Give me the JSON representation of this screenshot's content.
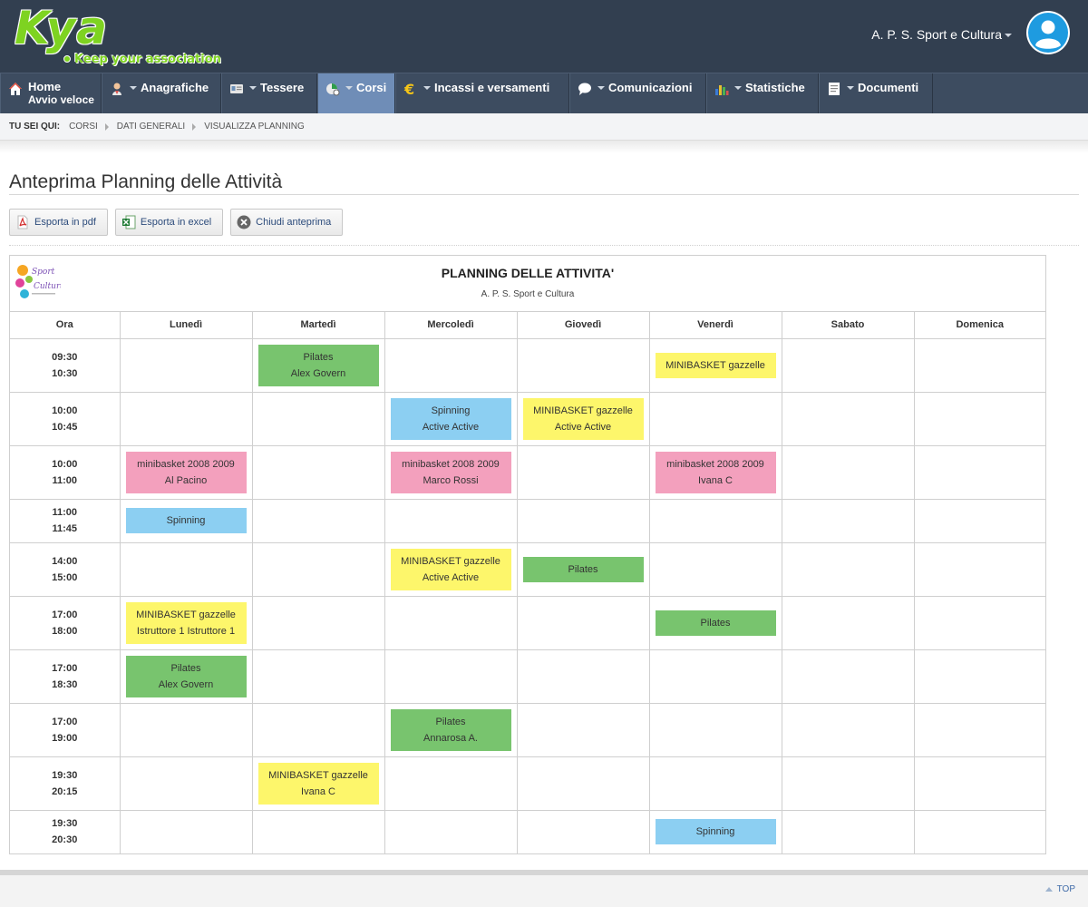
{
  "header": {
    "logo_word": "Kya",
    "logo_tagline": "Keep your association",
    "user_name": "A. P. S. Sport e Cultura"
  },
  "nav": {
    "home_label": "Home",
    "home_sublabel": "Avvio veloce",
    "items": [
      {
        "label": "Anagrafiche",
        "icon": "person-icon"
      },
      {
        "label": "Tessere",
        "icon": "card-icon"
      },
      {
        "label": "Corsi",
        "icon": "courses-icon",
        "active": true
      },
      {
        "label": "Incassi e versamenti",
        "icon": "euro-icon"
      },
      {
        "label": "Comunicazioni",
        "icon": "speech-bubble-icon"
      },
      {
        "label": "Statistiche",
        "icon": "bar-chart-icon"
      },
      {
        "label": "Documenti",
        "icon": "document-icon"
      }
    ]
  },
  "breadcrumb": {
    "label": "TU SEI QUI:",
    "items": [
      "CORSI",
      "DATI GENERALI",
      "VISUALIZZA PLANNING"
    ]
  },
  "page": {
    "title": "Anteprima Planning delle Attività"
  },
  "buttons": {
    "pdf": "Esporta in pdf",
    "excel": "Esporta in excel",
    "close": "Chiudi anteprima"
  },
  "planning": {
    "title": "PLANNING DELLE ATTIVITA'",
    "org": "A. P. S. Sport e Cultura",
    "logo_text": "SPORT & CULTURA",
    "columns": [
      "Ora",
      "Lunedì",
      "Martedì",
      "Mercoledì",
      "Giovedì",
      "Venerdì",
      "Sabato",
      "Domenica"
    ],
    "colors": {
      "green": "#78c46e",
      "yellow": "#fdf66b",
      "blue": "#8ccff2",
      "pink": "#f3a0bd"
    },
    "rows": [
      {
        "start": "09:30",
        "end": "10:30",
        "events": [
          {
            "day": 2,
            "color": "green",
            "lines": [
              "Pilates",
              "Alex Govern"
            ]
          },
          {
            "day": 5,
            "color": "yellow",
            "lines": [
              "MINIBASKET gazzelle"
            ]
          }
        ]
      },
      {
        "start": "10:00",
        "end": "10:45",
        "events": [
          {
            "day": 3,
            "color": "blue",
            "lines": [
              "Spinning",
              "Active Active"
            ]
          },
          {
            "day": 4,
            "color": "yellow",
            "lines": [
              "MINIBASKET gazzelle",
              "Active Active"
            ]
          }
        ]
      },
      {
        "start": "10:00",
        "end": "11:00",
        "events": [
          {
            "day": 1,
            "color": "pink",
            "lines": [
              "minibasket 2008 2009",
              "Al Pacino"
            ]
          },
          {
            "day": 3,
            "color": "pink",
            "lines": [
              "minibasket 2008 2009",
              "Marco Rossi"
            ]
          },
          {
            "day": 5,
            "color": "pink",
            "lines": [
              "minibasket 2008 2009",
              "Ivana C"
            ]
          }
        ]
      },
      {
        "start": "11:00",
        "end": "11:45",
        "events": [
          {
            "day": 1,
            "color": "blue",
            "lines": [
              "Spinning"
            ]
          }
        ]
      },
      {
        "start": "14:00",
        "end": "15:00",
        "events": [
          {
            "day": 3,
            "color": "yellow",
            "lines": [
              "MINIBASKET gazzelle",
              "Active Active"
            ]
          },
          {
            "day": 4,
            "color": "green",
            "lines": [
              "Pilates"
            ]
          }
        ]
      },
      {
        "start": "17:00",
        "end": "18:00",
        "events": [
          {
            "day": 1,
            "color": "yellow",
            "lines": [
              "MINIBASKET gazzelle",
              "Istruttore 1 Istruttore 1"
            ]
          },
          {
            "day": 5,
            "color": "green",
            "lines": [
              "Pilates"
            ]
          }
        ]
      },
      {
        "start": "17:00",
        "end": "18:30",
        "events": [
          {
            "day": 1,
            "color": "green",
            "lines": [
              "Pilates",
              "Alex Govern"
            ]
          }
        ]
      },
      {
        "start": "17:00",
        "end": "19:00",
        "events": [
          {
            "day": 3,
            "color": "green",
            "lines": [
              "Pilates",
              "Annarosa A."
            ]
          }
        ]
      },
      {
        "start": "19:30",
        "end": "20:15",
        "events": [
          {
            "day": 2,
            "color": "yellow",
            "lines": [
              "MINIBASKET gazzelle",
              "Ivana C"
            ]
          }
        ]
      },
      {
        "start": "19:30",
        "end": "20:30",
        "events": [
          {
            "day": 5,
            "color": "blue",
            "lines": [
              "Spinning"
            ]
          }
        ]
      }
    ]
  },
  "footer": {
    "top_label": "TOP"
  }
}
